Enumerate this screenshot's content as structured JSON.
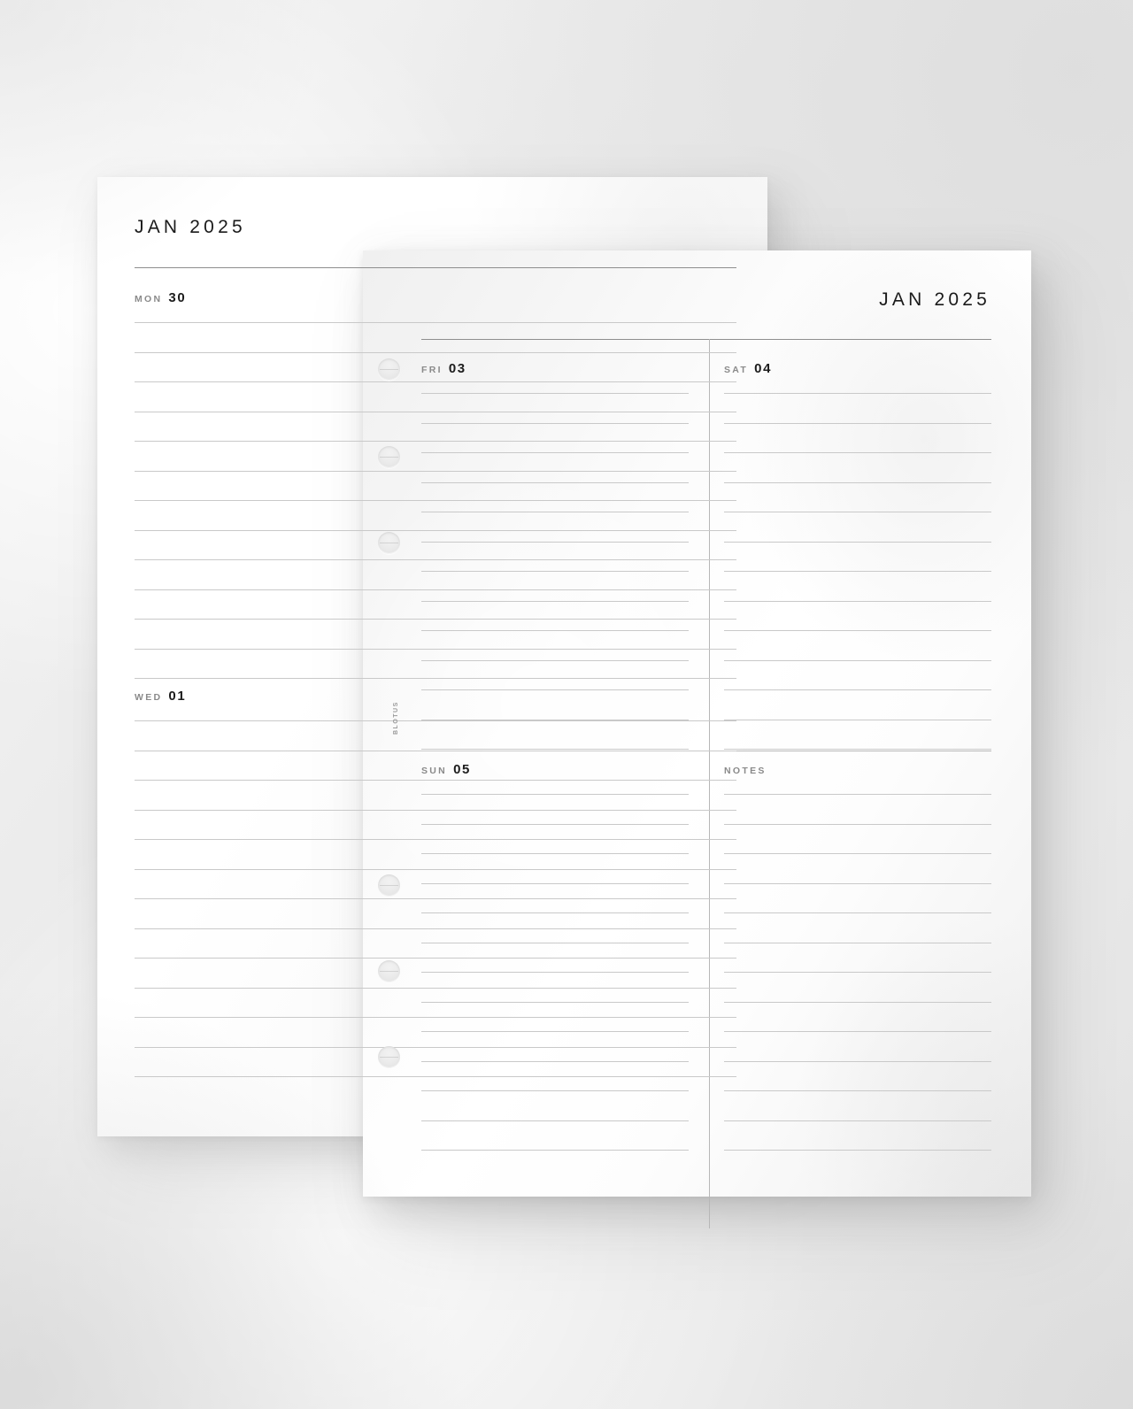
{
  "document": {
    "type": "planner-insert-mockup",
    "brand": "BLOTUS",
    "background_color": "#e8e8e8",
    "paper_color": "#ffffff",
    "rule_color": "#c9c9c9",
    "divider_color": "#b7b7b7",
    "heading_color": "#1a1a1a",
    "label_color": "#8a8a8a"
  },
  "back_page": {
    "title": "JAN 2025",
    "blocks": [
      {
        "abbr": "MON",
        "num": "30",
        "lines": 13
      },
      {
        "abbr": "WED",
        "num": "01",
        "lines": 13
      }
    ]
  },
  "front_page": {
    "title": "JAN 2025",
    "quadrants": [
      {
        "abbr": "FRI",
        "num": "03",
        "lines": 13,
        "position": "top-left"
      },
      {
        "abbr": "SAT",
        "num": "04",
        "lines": 13,
        "position": "top-right"
      },
      {
        "abbr": "SUN",
        "num": "05",
        "lines": 13,
        "position": "bottom-left"
      },
      {
        "abbr": "NOTES",
        "num": "",
        "lines": 13,
        "position": "bottom-right"
      }
    ],
    "binder_holes": 6
  }
}
